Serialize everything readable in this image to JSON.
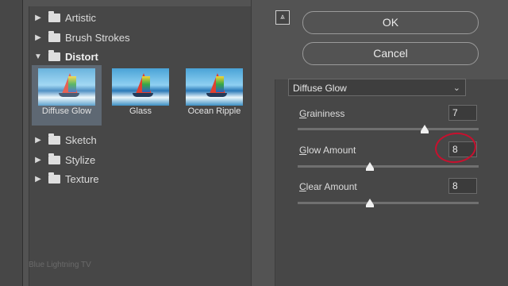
{
  "tree": {
    "categories_top": [
      {
        "label": "Artistic"
      },
      {
        "label": "Brush Strokes"
      },
      {
        "label": "Distort"
      }
    ],
    "thumbnails": [
      {
        "label": "Diffuse Glow",
        "selected": true
      },
      {
        "label": "Glass",
        "selected": false
      },
      {
        "label": "Ocean Ripple",
        "selected": false
      }
    ],
    "categories_bottom": [
      {
        "label": "Sketch"
      },
      {
        "label": "Stylize"
      },
      {
        "label": "Texture"
      }
    ],
    "icons": {
      "collapsed": "triangle-right-icon",
      "expanded": "triangle-down-icon",
      "folder": "folder-icon"
    }
  },
  "watermark": "Blue Lightning TV",
  "buttons": {
    "ok": "OK",
    "cancel": "Cancel"
  },
  "collapse_icon": "⩓",
  "filter": {
    "selected": "Diffuse Glow"
  },
  "params": [
    {
      "label": "Graininess",
      "value": "7",
      "level": 0.7
    },
    {
      "label": "Glow Amount",
      "value": "8",
      "level": 0.4
    },
    {
      "label": "Clear Amount",
      "value": "8",
      "level": 0.4
    }
  ],
  "colors": {
    "highlight": "#c8102e",
    "selection": "#5e6873"
  }
}
